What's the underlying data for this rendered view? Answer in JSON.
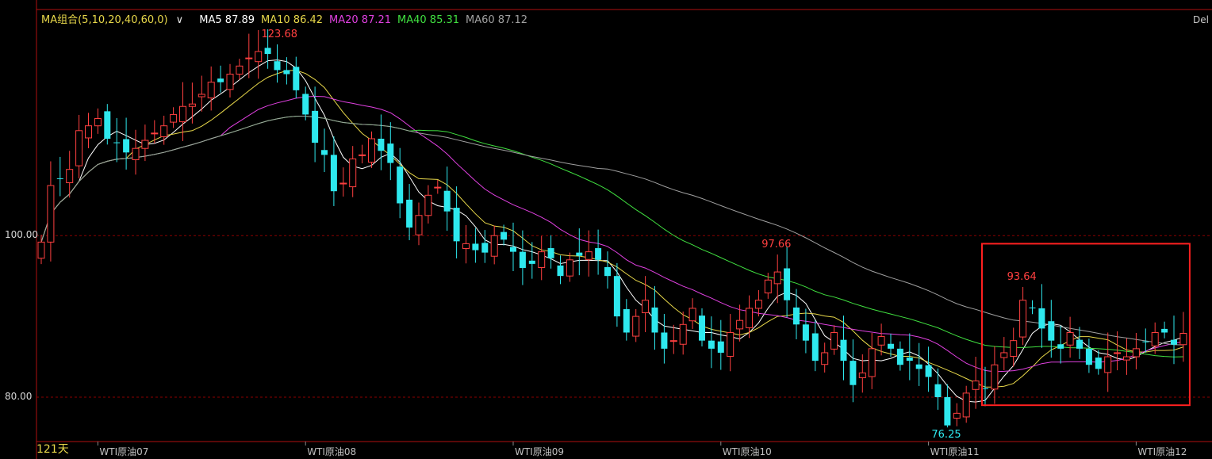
{
  "ma_legend": {
    "header": "MA组合(5,10,20,40,60,0)",
    "items": [
      {
        "label": "MA5 87.89",
        "color": "#ffffff"
      },
      {
        "label": "MA10 86.42",
        "color": "#e8d84a"
      },
      {
        "label": "MA20 87.21",
        "color": "#e040e0"
      },
      {
        "label": "MA40 85.31",
        "color": "#40e040"
      },
      {
        "label": "MA60 87.12",
        "color": "#a0a0a0"
      }
    ]
  },
  "corner_text": "Del",
  "period_label": "121天",
  "colors": {
    "up": "#ff4040",
    "down": "#2ee8ee",
    "grid": "#8b0000",
    "frame": "#b01010",
    "highlight": "#ff2020"
  },
  "chart_data": {
    "type": "candlestick",
    "y_ticks": [
      {
        "value": 100,
        "label": "100.00"
      },
      {
        "value": 80,
        "label": "80.00"
      }
    ],
    "ylim": [
      74.5,
      128
    ],
    "x_labels": [
      "WTI原油07",
      "WTI原油08",
      "WTI原油09",
      "WTI原油10",
      "WTI原油11",
      "WTI原油12"
    ],
    "x_label_index": [
      6,
      28,
      50,
      72,
      94,
      116
    ],
    "annotations": [
      {
        "label": "123.68",
        "index": 25,
        "value": 123.68,
        "kind": "high"
      },
      {
        "label": "97.66",
        "index": 78,
        "value": 97.66,
        "kind": "high"
      },
      {
        "label": "76.25",
        "index": 96,
        "value": 76.25,
        "kind": "low"
      },
      {
        "label": "93.64",
        "index": 104,
        "value": 93.64,
        "kind": "high"
      }
    ],
    "highlight_box": {
      "from_index": 100,
      "to_index": 121,
      "ymin": 79.0,
      "ymax": 99.0
    },
    "closes": [
      99.2,
      106.2,
      107.0,
      108.2,
      113.0,
      113.6,
      114.5,
      112.0,
      111.5,
      110.3,
      110.8,
      111.8,
      112.7,
      113.6,
      115.0,
      116.0,
      116.3,
      117.5,
      119.0,
      119.0,
      120.0,
      121.0,
      122.0,
      122.8,
      122.5,
      120.5,
      120.0,
      118.0,
      115.0,
      111.5,
      110.0,
      105.5,
      106.5,
      109.5,
      110.0,
      112.0,
      110.5,
      109.0,
      104.0,
      101.0,
      102.5,
      105.0,
      106.0,
      103.0,
      99.3,
      99.0,
      98.2,
      97.9,
      100.0,
      99.5,
      98.0,
      96.0,
      96.5,
      98.0,
      97.2,
      95.0,
      97.0,
      97.5,
      98.0,
      97.0,
      95.0,
      90.0,
      88.0,
      90.0,
      92.0,
      88.0,
      86.0,
      87.0,
      89.0,
      91.0,
      87.0,
      86.0,
      85.5,
      88.0,
      89.5,
      91.0,
      92.0,
      94.5,
      95.5,
      92.0,
      89.0,
      87.0,
      84.5,
      85.5,
      88.0,
      84.5,
      81.5,
      83.0,
      86.0,
      87.5,
      86.0,
      84.0,
      84.5,
      83.5,
      82.5,
      80.0,
      76.5,
      78.0,
      80.5,
      82.0,
      81.0,
      84.0,
      85.5,
      87.0,
      92.0,
      91.0,
      88.5,
      87.0,
      86.0,
      88.0,
      86.0,
      84.0,
      83.5,
      85.0,
      85.5,
      85.0,
      86.0,
      86.8,
      88.0,
      88.0,
      86.5,
      87.9
    ]
  }
}
